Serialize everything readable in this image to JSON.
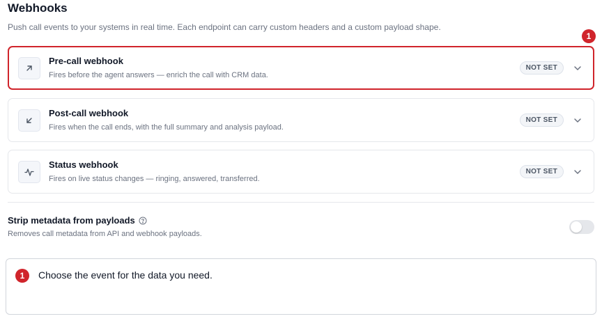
{
  "page": {
    "title": "Webhooks",
    "subtitle": "Push call events to your systems in real time. Each endpoint can carry custom headers and a custom payload shape."
  },
  "webhooks": [
    {
      "title": "Pre-call webhook",
      "description": "Fires before the agent answers — enrich the call with CRM data.",
      "status": "NOT SET",
      "icon": "arrow-up-right-icon"
    },
    {
      "title": "Post-call webhook",
      "description": "Fires when the call ends, with the full summary and analysis payload.",
      "status": "NOT SET",
      "icon": "arrow-down-left-icon"
    },
    {
      "title": "Status webhook",
      "description": "Fires on live status changes — ringing, answered, transferred.",
      "status": "NOT SET",
      "icon": "activity-icon"
    }
  ],
  "strip_metadata": {
    "label": "Strip metadata from payloads",
    "description": "Removes call metadata from API and webhook payloads.",
    "enabled": false
  },
  "annotation": {
    "marker": "1",
    "text": "Choose the event for the data you need.",
    "accent_color": "#d0242b"
  }
}
